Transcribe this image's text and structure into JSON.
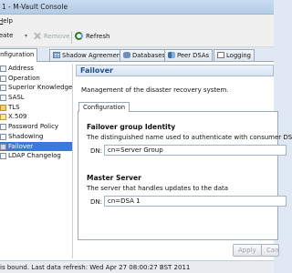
{
  "window": {
    "title": "1 - M-Vault Console"
  },
  "menu": {
    "help": "Help"
  },
  "toolbar": {
    "create_label": "reate",
    "remove_label": "Remove",
    "refresh_label": "Refresh",
    "dropdown_glyph": "▾"
  },
  "tabs": [
    {
      "label": "onfiguration",
      "icon": "configuration-icon",
      "active": true
    },
    {
      "label": "Shadow Agreements",
      "icon": "grid-icon",
      "active": false
    },
    {
      "label": "Databases",
      "icon": "database-icon",
      "active": false
    },
    {
      "label": "Peer DSAs",
      "icon": "peer-dsa-icon",
      "active": false
    },
    {
      "label": "Logging",
      "icon": "log-icon",
      "active": false
    }
  ],
  "nav": {
    "items": [
      {
        "label": "Address"
      },
      {
        "label": "Operation"
      },
      {
        "label": "Superior Knowledge"
      },
      {
        "label": "SASL"
      },
      {
        "label": "TLS"
      },
      {
        "label": "X.509"
      },
      {
        "label": "Password Policy"
      },
      {
        "label": "Shadowing"
      },
      {
        "label": "Failover",
        "selected": true
      },
      {
        "label": "LDAP Changelog"
      }
    ]
  },
  "content": {
    "header": "Failover",
    "description": "Management of the disaster recovery system.",
    "tab_label": "Configuration",
    "sections": [
      {
        "title": "Failover group Identity",
        "description": "The distinguished name used to authenticate with consumer DSAs",
        "dn_label": "DN:",
        "dn_value": "cn=Server Group"
      },
      {
        "title": "Master Server",
        "description": "The server that handles updates to the data",
        "dn_label": "DN:",
        "dn_value": "cn=DSA 1"
      }
    ],
    "apply_label": "Apply",
    "cancel_label": "Cancel"
  },
  "status": {
    "text": "is bound. Last data refresh: Wed Apr 27 08:00:27 BST 2011"
  },
  "colors": {
    "selection": "#3a7bd5",
    "header_text": "#1f4e8c",
    "title_bar": "#c9dcf0"
  }
}
